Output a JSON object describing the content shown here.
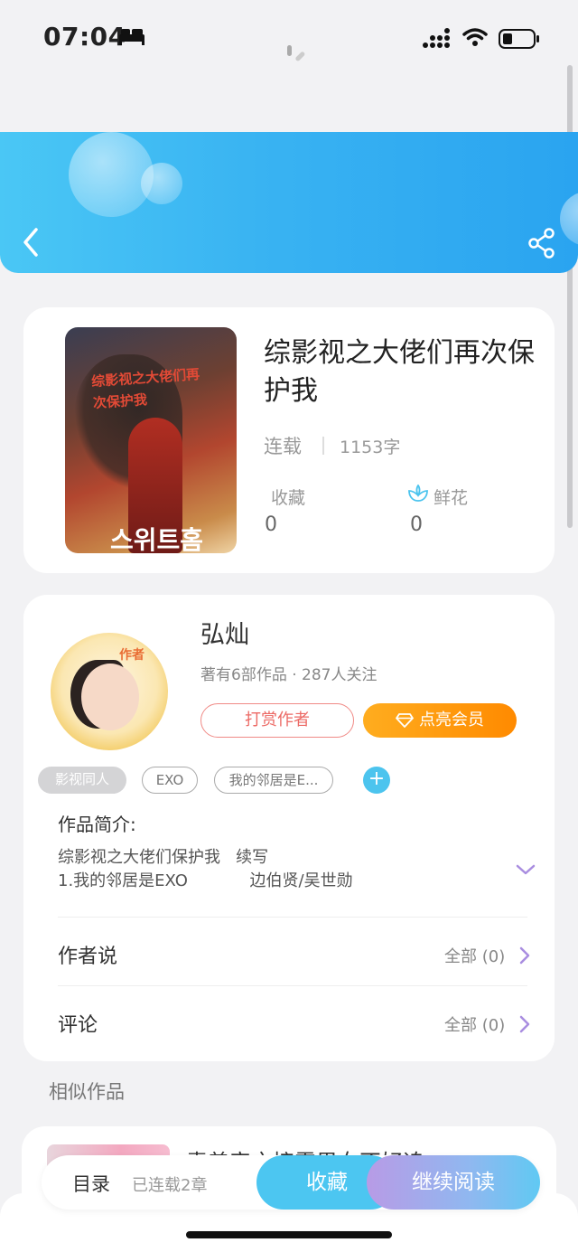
{
  "status_bar": {
    "time": "07:04"
  },
  "header": {
    "back_icon": "chevron-left-icon",
    "share_icon": "share-icon"
  },
  "book": {
    "title": "综影视之大佬们再次保护我",
    "status": "连载",
    "word_count": "1153字",
    "favorites_label": "收藏",
    "favorites_value": "0",
    "flowers_label": "鲜花",
    "flowers_value": "0",
    "cover_title": "综影视之大佬们再次保护我",
    "cover_brand": "스위트홈"
  },
  "author": {
    "name": "弘灿",
    "meta": "著有6部作品 · 287人关注",
    "avatar_tag": "作者",
    "tip_button": "打赏作者",
    "vip_button": "点亮会员"
  },
  "tags": [
    "影视同人",
    "EXO",
    "我的邻居是E..."
  ],
  "intro": {
    "title": "作品简介:",
    "lines": [
      "综影视之大佬们保护我   续写",
      "1.我的邻居是EXO            边伯贤/吴世勋"
    ]
  },
  "rows": [
    {
      "title": "作者说",
      "link": "全部 (0)"
    },
    {
      "title": "评论",
      "link": "全部 (0)"
    }
  ],
  "similar": {
    "title": "相似作品",
    "first_item_text": "青羞帝之接露男女不好追"
  },
  "bottom_bar": {
    "toc": "目录",
    "serial": "已连载2章",
    "collect": "收藏",
    "continue_reading": "继续阅读"
  },
  "colors": {
    "accent_blue": "#39b3f2",
    "vip_orange": "#ff8a00",
    "tip_red": "#ec6a65"
  }
}
